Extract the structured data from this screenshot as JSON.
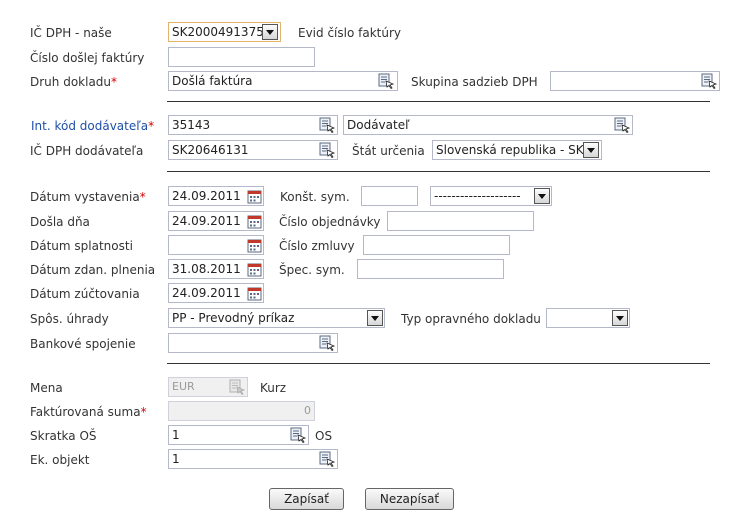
{
  "fields": {
    "ic_dph_nase": {
      "label": "IČ DPH - naše",
      "value": "SK2000491375"
    },
    "evid_cislo": {
      "label": "Evid číslo faktúry"
    },
    "cislo_faktury": {
      "label": "Číslo došlej faktúry",
      "value": ""
    },
    "druh_dokladu": {
      "label": "Druh dokladu",
      "value": "Došlá faktúra"
    },
    "skupina_sadzieb": {
      "label": "Skupina sadzieb DPH",
      "value": ""
    },
    "int_kod": {
      "label": "Int. kód dodávateľa",
      "value": "35143"
    },
    "dodavatel": {
      "value": "Dodávateľ"
    },
    "ic_dph_dodavatela": {
      "label": "IČ DPH dodávateľa",
      "value": "SK20646131"
    },
    "stat_urcenia": {
      "label": "Štát určenia",
      "value": "Slovenská republika - SK"
    },
    "datum_vystavenia": {
      "label": "Dátum vystavenia",
      "value": "24.09.2011"
    },
    "konst_sym": {
      "label": "Konšt. sym.",
      "value": "",
      "select_value": "--------------------"
    },
    "dosla_dna": {
      "label": "Došla dňa",
      "value": "24.09.2011"
    },
    "cislo_objednavky": {
      "label": "Číslo objednávky",
      "value": ""
    },
    "datum_splatnosti": {
      "label": "Dátum splatnosti",
      "value": ""
    },
    "cislo_zmluvy": {
      "label": "Číslo zmluvy",
      "value": ""
    },
    "datum_zdan_plnenia": {
      "label": "Dátum zdan. plnenia",
      "value": "31.08.2011"
    },
    "spec_sym": {
      "label": "Špec. sym.",
      "value": ""
    },
    "datum_zuctovania": {
      "label": "Dátum zúčtovania",
      "value": "24.09.2011"
    },
    "spos_uhrady": {
      "label": "Spôs. úhrady",
      "value": "PP - Prevodný príkaz"
    },
    "typ_opravneho": {
      "label": "Typ opravného dokladu",
      "value": ""
    },
    "bankove_spojenie": {
      "label": "Bankové spojenie",
      "value": ""
    },
    "mena": {
      "label": "Mena",
      "value": "EUR"
    },
    "kurz": {
      "label": "Kurz"
    },
    "fakturovana_suma": {
      "label": "Faktúrovaná suma",
      "value": "0"
    },
    "skratka_os": {
      "label": "Skratka OŠ",
      "value": "1",
      "suffix": "OS"
    },
    "ek_objekt": {
      "label": "Ek. objekt",
      "value": "1"
    }
  },
  "required_mark": "*",
  "buttons": {
    "save": "Zapísať",
    "cancel": "Nezapísať"
  },
  "colors": {
    "required": "#d40000",
    "link_label": "#1f4fa8",
    "calendar_icon": "#c0392b"
  }
}
